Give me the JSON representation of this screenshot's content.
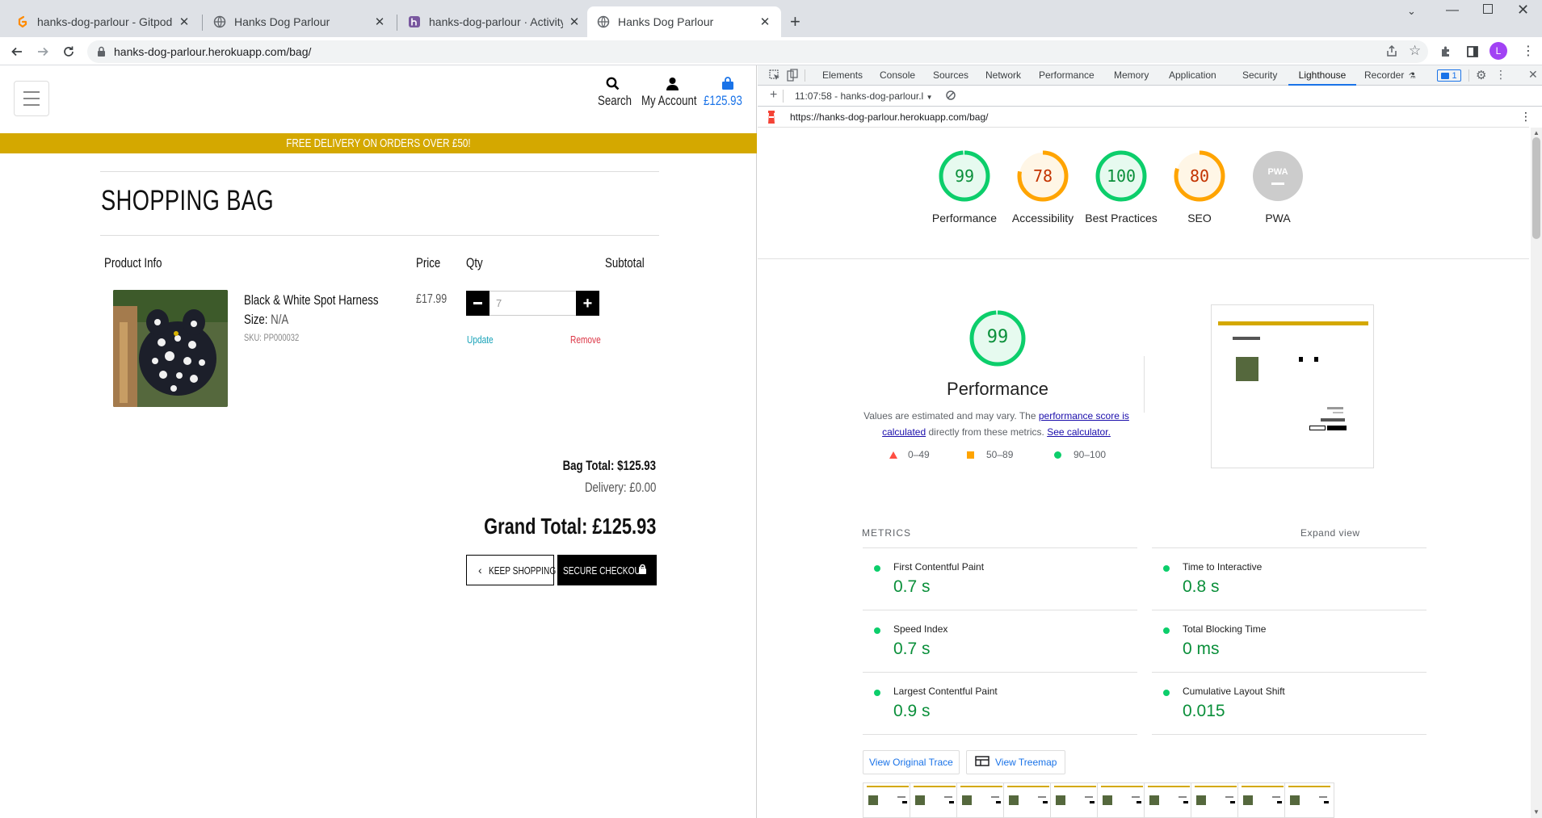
{
  "browser": {
    "tabs": [
      {
        "title": "hanks-dog-parlour - Gitpod Code",
        "favicon": "gitpod-icon"
      },
      {
        "title": "Hanks Dog Parlour",
        "favicon": "globe-icon"
      },
      {
        "title": "hanks-dog-parlour · Activity | Heroku",
        "favicon": "heroku-icon"
      },
      {
        "title": "Hanks Dog Parlour",
        "favicon": "globe-icon"
      }
    ],
    "url": "hanks-dog-parlour.herokuapp.com/bag/",
    "profile_initial": "L"
  },
  "site": {
    "header": {
      "search_label": "Search",
      "account_label": "My Account",
      "bag_total": "£125.93"
    },
    "banner": "FREE DELIVERY ON ORDERS OVER £50!",
    "bag": {
      "title": "SHOPPING BAG",
      "columns": {
        "product": "Product Info",
        "price": "Price",
        "qty": "Qty",
        "subtotal": "Subtotal"
      },
      "item": {
        "name": "Black & White Spot Harness",
        "size_label": "Size:",
        "size_value": "N/A",
        "sku": "SKU: PP000032",
        "price": "£17.99",
        "qty": "7",
        "update": "Update",
        "remove": "Remove"
      },
      "bag_total": "Bag Total: $125.93",
      "delivery": "Delivery: £0.00",
      "grand_total": "Grand Total: £125.93",
      "keep_shopping": "KEEP SHOPPING",
      "secure_checkout": "SECURE CHECKOUT"
    }
  },
  "devtools": {
    "tabs": [
      "Elements",
      "Console",
      "Sources",
      "Network",
      "Performance",
      "Memory",
      "Application",
      "Security",
      "Lighthouse",
      "Recorder"
    ],
    "active_tab": "Lighthouse",
    "issues_count": "1",
    "report_selector": "11:07:58 - hanks-dog-parlour.l",
    "report_url": "https://hanks-dog-parlour.herokuapp.com/bag/",
    "scores": [
      {
        "label": "Performance",
        "value": "99",
        "status": "pass"
      },
      {
        "label": "Accessibility",
        "value": "78",
        "status": "average"
      },
      {
        "label": "Best Practices",
        "value": "100",
        "status": "pass"
      },
      {
        "label": "SEO",
        "value": "80",
        "status": "average"
      },
      {
        "label": "PWA",
        "value": "PWA",
        "status": "na"
      }
    ],
    "perf": {
      "score": "99",
      "title": "Performance",
      "desc_prefix": "Values are estimated and may vary. The ",
      "desc_link": "performance score is calculated",
      "desc_mid": " directly from these metrics. ",
      "desc_link2": "See calculator.",
      "legend": [
        {
          "range": "0–49",
          "color": "#ff4e42"
        },
        {
          "range": "50–89",
          "color": "#ffa400"
        },
        {
          "range": "90–100",
          "color": "#0cce6b"
        }
      ]
    },
    "metrics_header": "METRICS",
    "expand_view": "Expand view",
    "metrics": [
      {
        "name": "First Contentful Paint",
        "value": "0.7 s"
      },
      {
        "name": "Time to Interactive",
        "value": "0.8 s"
      },
      {
        "name": "Speed Index",
        "value": "0.7 s"
      },
      {
        "name": "Total Blocking Time",
        "value": "0 ms"
      },
      {
        "name": "Largest Contentful Paint",
        "value": "0.9 s"
      },
      {
        "name": "Cumulative Layout Shift",
        "value": "0.015"
      }
    ],
    "view_trace": "View Original Trace",
    "view_treemap": "View Treemap"
  },
  "colors": {
    "banner": "#d4a800",
    "pass": "#0cce6b",
    "average": "#ffa400",
    "link": "#1a0dab",
    "brand_blue": "#1a73e8"
  }
}
